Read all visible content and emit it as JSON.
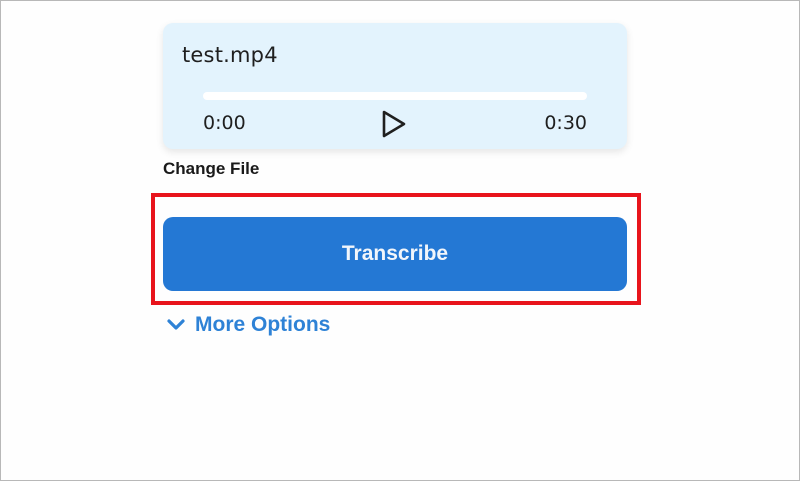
{
  "player": {
    "file_name": "test.mp4",
    "progress_fraction": 0,
    "current_time": "0:00",
    "total_time": "0:30",
    "play_icon": "play-icon"
  },
  "change_file_label": "Change File",
  "transcribe_label": "Transcribe",
  "more_options": {
    "label": "More Options",
    "icon": "chevron-down-icon"
  },
  "colors": {
    "card_bg": "#e3f3fd",
    "primary": "#2478d4",
    "link": "#2e82d6",
    "highlight": "#e8141c"
  }
}
